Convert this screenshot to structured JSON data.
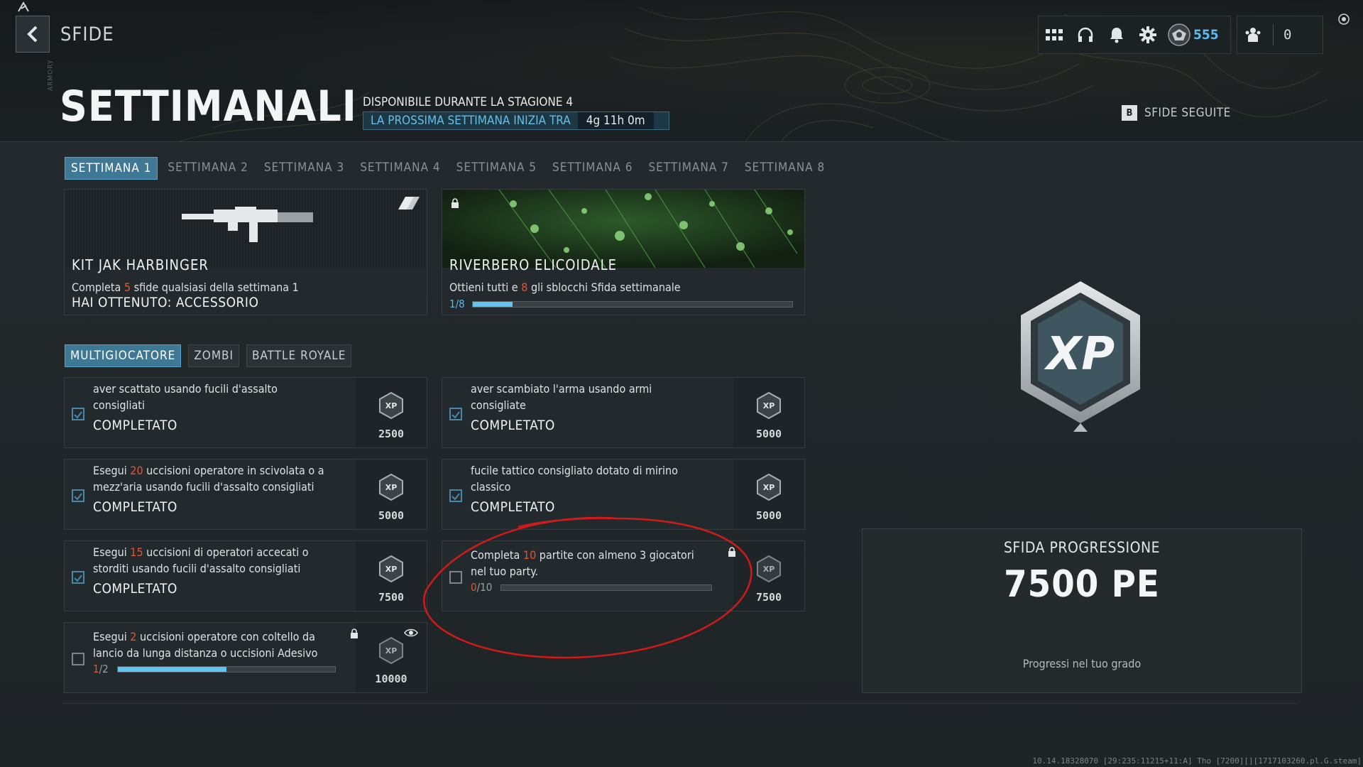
{
  "header": {
    "page_title": "SFIDE",
    "currency_value": "555",
    "friends_count": "0",
    "icons": [
      "grid-icon",
      "headset-icon",
      "bell-icon",
      "gear-icon",
      "rank-emblem-icon",
      "friends-icon"
    ]
  },
  "hero": {
    "title": "SETTIMANALI",
    "availability": "DISPONIBILE DURANTE LA STAGIONE 4",
    "next_week_label": "LA PROSSIMA SETTIMANA INIZIA TRA",
    "next_week_timer": "4g 11h 0m",
    "followed_key": "B",
    "followed_label": "SFIDE SEGUITE",
    "vertical_tag": "ARMORY"
  },
  "week_tabs": [
    "SETTIMANA 1",
    "SETTIMANA 2",
    "SETTIMANA 3",
    "SETTIMANA 4",
    "SETTIMANA 5",
    "SETTIMANA 6",
    "SETTIMANA 7",
    "SETTIMANA 8"
  ],
  "rewards": [
    {
      "title": "KIT JAK HARBINGER",
      "desc_pre": "Completa ",
      "desc_num": "5",
      "desc_post": " sfide qualsiasi della settimana 1",
      "status": "HAI OTTENUTO: ACCESSORIO"
    },
    {
      "title": "RIVERBERO ELICOIDALE",
      "desc_pre": "Ottieni tutti e ",
      "desc_num": "8",
      "desc_post": " gli sblocchi Sfida settimanale",
      "progress_text": "1/8",
      "progress": 0.125
    }
  ],
  "mode_tabs": [
    "MULTIGIOCATORE",
    "ZOMBI",
    "BATTLE ROYALE"
  ],
  "challenges": [
    {
      "line1": "aver scattato usando fucili d'assalto",
      "line2": "consigliati",
      "status": "COMPLETATO",
      "xp": "2500"
    },
    {
      "line1": "aver scambiato l'arma usando armi",
      "line2": "consigliate",
      "status": "COMPLETATO",
      "xp": "5000"
    },
    {
      "pre": "Esegui ",
      "num": "20",
      "post": " uccisioni operatore in scivolata o a",
      "line2": "mezz'aria usando fucili d'assalto consigliati",
      "status": "COMPLETATO",
      "xp": "5000"
    },
    {
      "line1": "fucile tattico consigliato dotato di mirino",
      "line2": "classico",
      "status": "COMPLETATO",
      "xp": "5000"
    },
    {
      "pre": "Esegui ",
      "num": "15",
      "post": " uccisioni di operatori accecati o",
      "line2": "storditi usando fucili d'assalto consigliati",
      "status": "COMPLETATO",
      "xp": "7500"
    },
    {
      "pre": "Completa ",
      "num": "10",
      "post": " partite con almeno 3 giocatori",
      "line2": "nel tuo party.",
      "progress_num": "0",
      "progress_den": "/10",
      "progress": 0.0,
      "xp": "7500"
    },
    {
      "pre": "Esegui ",
      "num": "2",
      "post": " uccisioni operatore con coltello da",
      "line2": "lancio da lunga distanza o uccisioni Adesivo",
      "progress_num": "1",
      "progress_den": "/2",
      "progress": 0.5,
      "xp": "10000"
    }
  ],
  "progression": {
    "label": "SFIDA PROGRESSIONE",
    "value": "7500 PE",
    "subtitle": "Progressi nel tuo grado"
  },
  "build_info": "10.14.18328070 [29:235:11215+11:A] Tho [7200][][1717103260.pl.G.steam]",
  "colors": {
    "accent": "#3e7895",
    "accent_light": "#5fb8e6",
    "highlight": "#e5552f",
    "annotation": "#d11a1a"
  }
}
